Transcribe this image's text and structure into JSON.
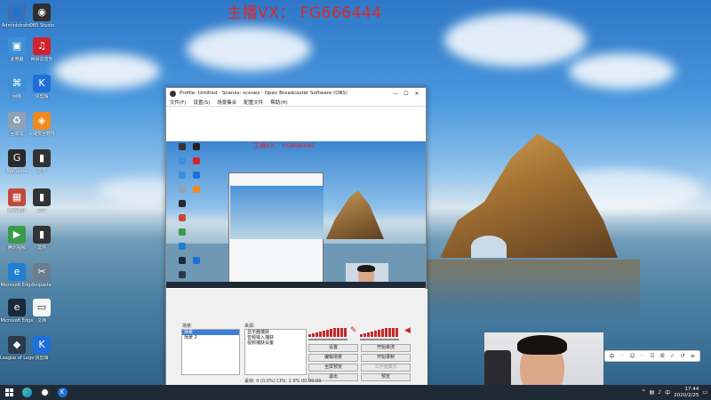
{
  "watermark": "主播VX： FG666444",
  "desktop_icons": [
    {
      "label": "Administrator",
      "icon": "user-folder-icon",
      "color": "#3b6fb5"
    },
    {
      "label": "OBS Studio",
      "icon": "obs-icon",
      "color": "#302e31"
    },
    {
      "label": "此电脑",
      "icon": "computer-icon",
      "color": "#3d8fd6"
    },
    {
      "label": "网易云音乐",
      "icon": "music-icon",
      "color": "#d0232b"
    },
    {
      "label": "网络",
      "icon": "network-icon",
      "color": "#3d8fd6"
    },
    {
      "label": "快剪辑",
      "icon": "k-app-icon",
      "color": "#1e6fd8"
    },
    {
      "label": "回收站",
      "icon": "recycle-bin-icon",
      "color": "#8fa2b5"
    },
    {
      "label": "火绒安全软件",
      "icon": "shield-icon",
      "color": "#f08a1c"
    },
    {
      "label": "WeGame",
      "icon": "wegame-icon",
      "color": "#2a2a2a"
    },
    {
      "label": "文件",
      "icon": "file-icon",
      "color": "#333333"
    },
    {
      "label": "腾讯游戏",
      "icon": "game-folder-icon",
      "color": "#c2493b"
    },
    {
      "label": "文件",
      "icon": "file-icon",
      "color": "#333333"
    },
    {
      "label": "腾讯视频",
      "icon": "video-icon",
      "color": "#3a9b4a"
    },
    {
      "label": "文件",
      "icon": "file-icon",
      "color": "#333333"
    },
    {
      "label": "Microsoft Edge",
      "icon": "edge-icon",
      "color": "#1f7fd0"
    },
    {
      "label": "Snipaste",
      "icon": "snip-icon",
      "color": "#6b7c8e"
    },
    {
      "label": "Microsoft Edge",
      "icon": "edge-icon",
      "color": "#1a2a3a"
    },
    {
      "label": "文档",
      "icon": "document-icon",
      "color": "#f4f6f8"
    },
    {
      "label": "League of Legends",
      "icon": "lol-icon",
      "color": "#2a3a4a"
    },
    {
      "label": "快剪辑",
      "icon": "k-app-icon",
      "color": "#1e6fd8"
    }
  ],
  "obs": {
    "title": "Profile: Untitled - Scenes: scenes - Open Broadcaster Software (OBS)",
    "menus": [
      "文件(F)",
      "设置(S)",
      "场景集合",
      "配置文件",
      "帮助(H)"
    ],
    "scenes_label": "场景:",
    "scenes": [
      "场景",
      "场景 2"
    ],
    "sources_label": "来源:",
    "sources": [
      "显示器捕获",
      "音频输入捕获",
      "视频捕获设备"
    ],
    "buttons": [
      "设置",
      "开始串流",
      "编辑场景",
      "开始录制",
      "全屏预览",
      "退出",
      "工作室模式",
      "预览"
    ],
    "status": "丢帧: 0 (0.0%)   CPU: 2.8%   00:00:00"
  },
  "preview": {
    "watermark": "主播VX： FG666444"
  },
  "ime": {
    "items": [
      "中",
      "·",
      "☺",
      "◦",
      "☷",
      "ꕥ",
      "✓",
      "↺",
      "≡"
    ]
  },
  "taskbar": {
    "time": "17:44",
    "date": "2020/2/25",
    "language": "中"
  }
}
